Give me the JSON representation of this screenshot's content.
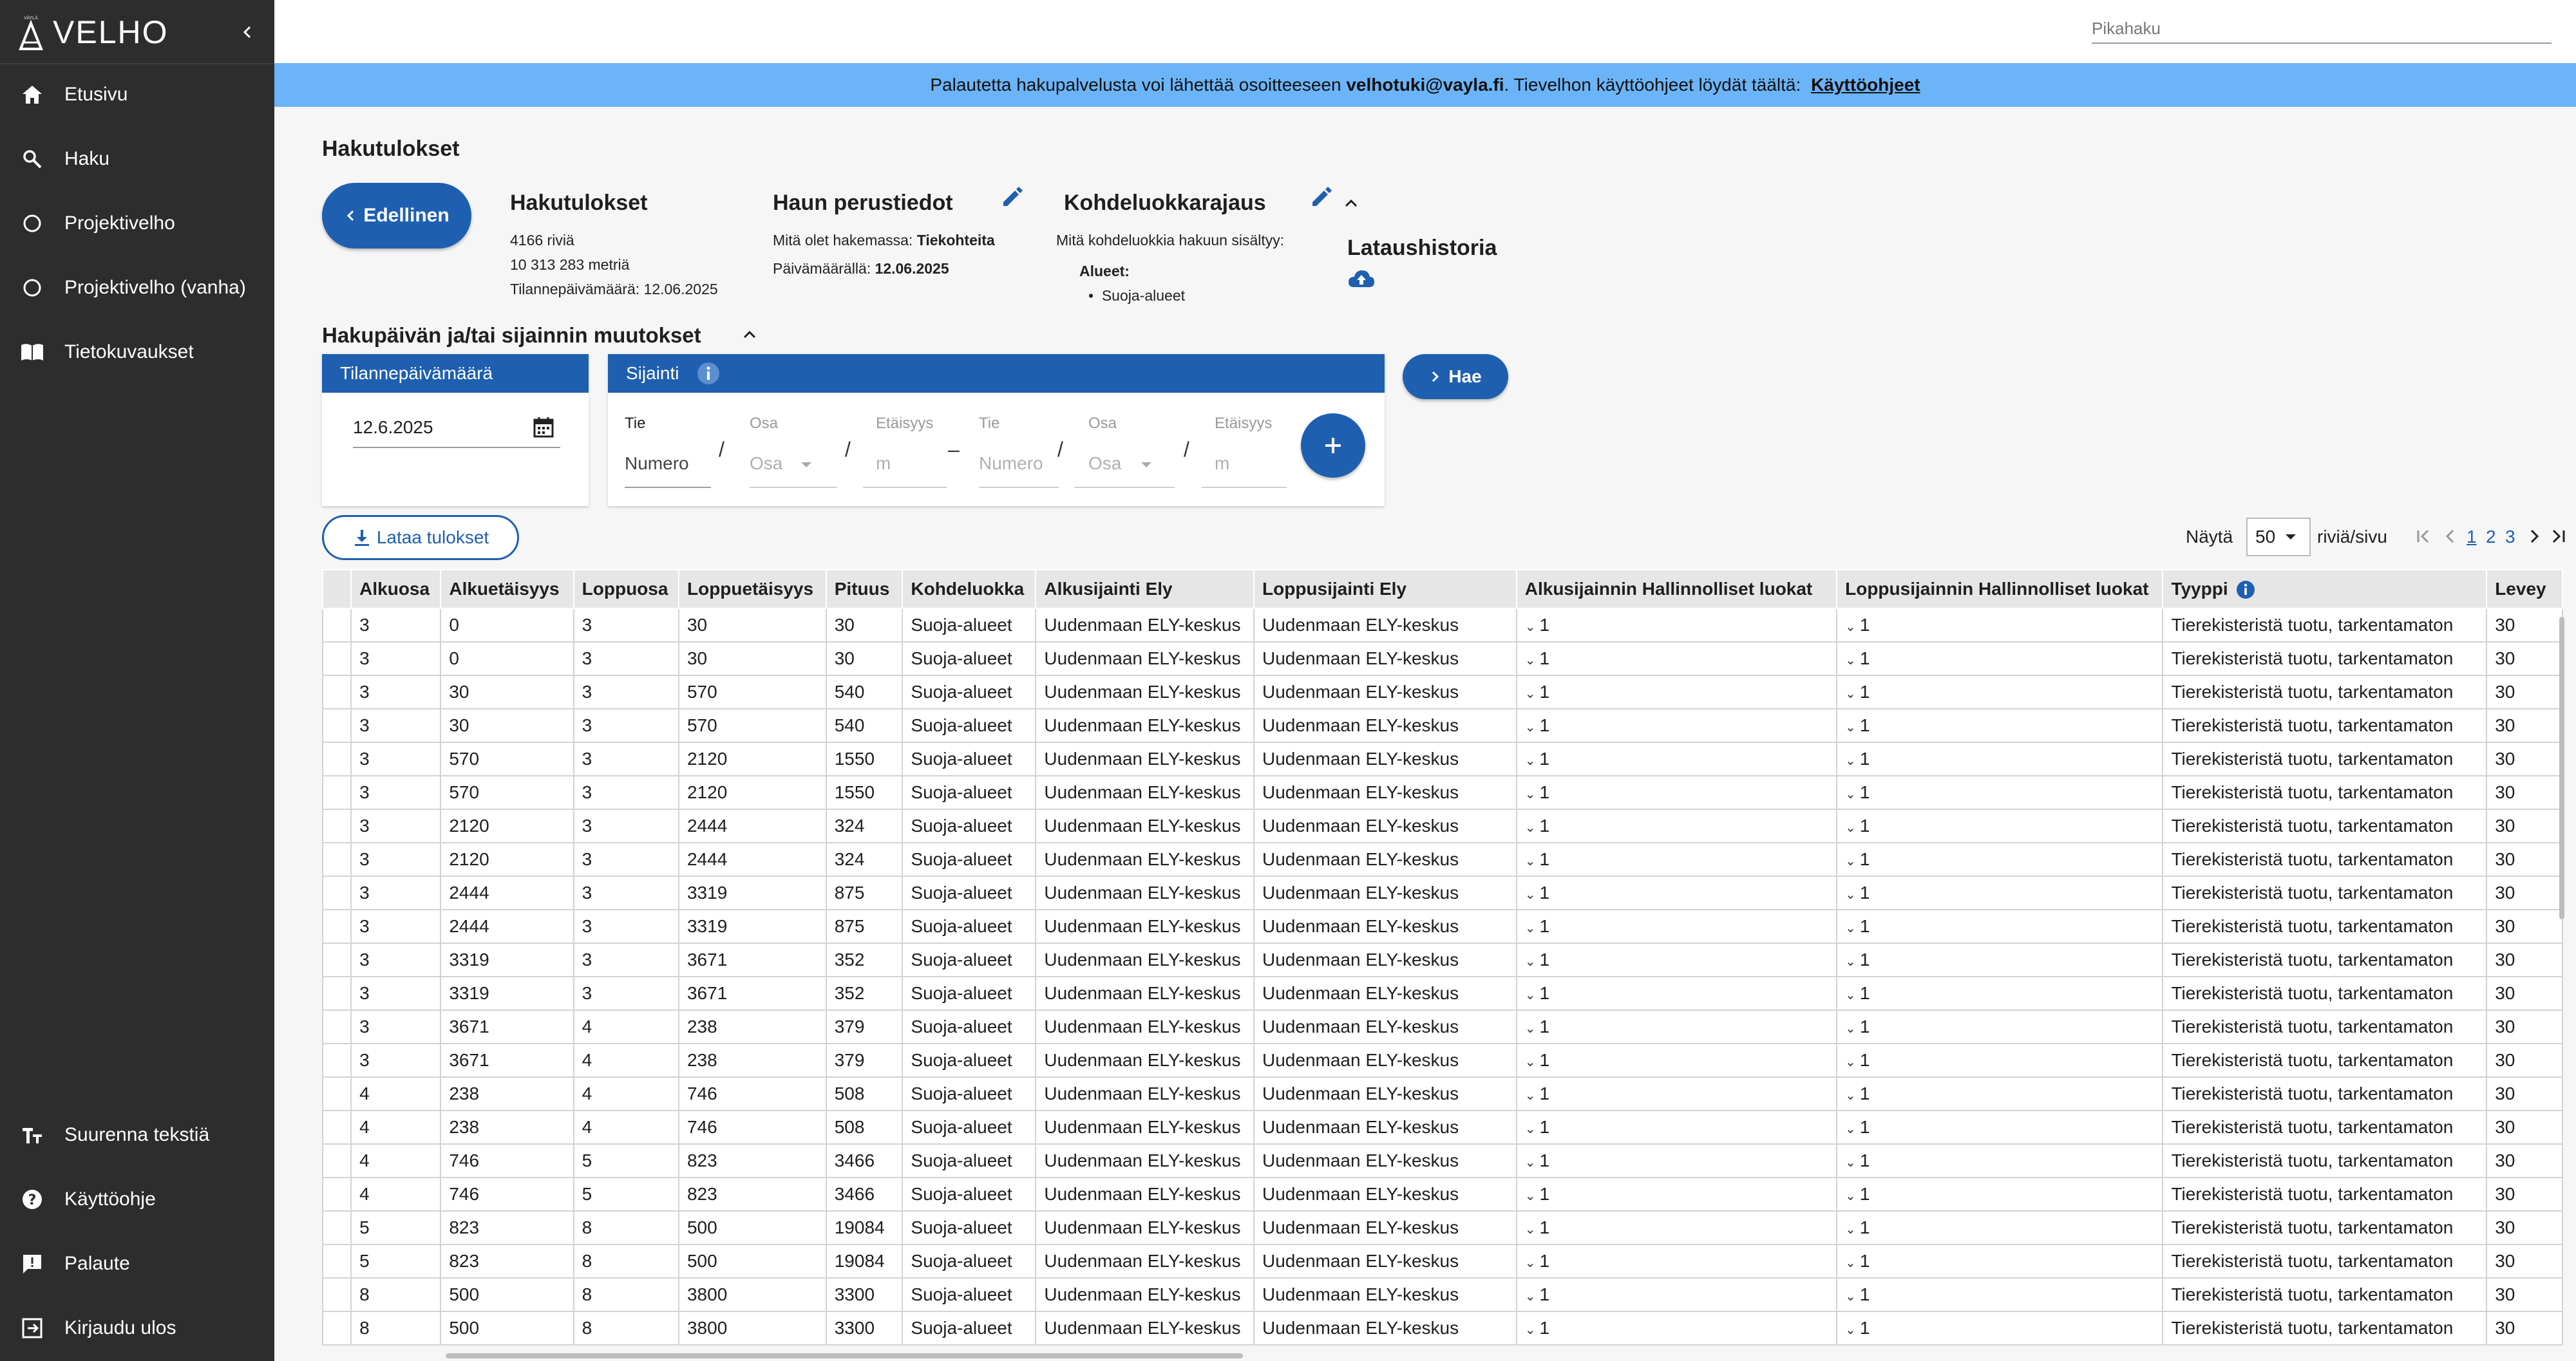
{
  "app": {
    "logo_text": "VELHO",
    "logo_small_text": "VÄYLÄ"
  },
  "sidebar": {
    "items": [
      {
        "label": "Etusivu",
        "icon": "home-icon"
      },
      {
        "label": "Haku",
        "icon": "search-icon"
      },
      {
        "label": "Projektivelho",
        "icon": "circle-icon"
      },
      {
        "label": "Projektivelho (vanha)",
        "icon": "circle-icon"
      },
      {
        "label": "Tietokuvaukset",
        "icon": "book-icon"
      }
    ],
    "bottom_items": [
      {
        "label": "Suurenna tekstiä",
        "icon": "text-size-icon"
      },
      {
        "label": "Käyttöohje",
        "icon": "help-icon"
      },
      {
        "label": "Palaute",
        "icon": "feedback-icon"
      },
      {
        "label": "Kirjaudu ulos",
        "icon": "logout-icon"
      }
    ]
  },
  "topbar": {
    "search_placeholder": "Pikahaku"
  },
  "banner": {
    "text_before": "Palautetta hakupalvelusta voi lähettää osoitteeseen ",
    "email": "velhotuki@vayla.fi",
    "text_middle": ". Tievelhon käyttöohjeet löydät täältä: ",
    "link": "Käyttöohjeet"
  },
  "page": {
    "title": "Hakutulokset",
    "back_label": "Edellinen",
    "results": {
      "title": "Hakutulokset",
      "rows": "4166 riviä",
      "length": "10 313 283 metriä",
      "date": "Tilannepäivämäärä: 12.06.2025"
    },
    "basics": {
      "title": "Haun perustiedot",
      "searching_label": "Mitä olet hakemassa:",
      "searching_value": "Tiekohteita",
      "date_label": "Päivämäärällä:",
      "date_value": "12.06.2025"
    },
    "classes": {
      "title": "Kohdeluokkarajaus",
      "question": "Mitä kohdeluokkia hakuun sisältyy:",
      "areas_label": "Alueet:",
      "areas_item": "Suoja-alueet"
    },
    "history": {
      "title": "Lataushistoria"
    },
    "changes_title": "Hakupäivän ja/tai sijainnin muutokset",
    "date_card": {
      "title": "Tilannepäivämäärä",
      "value": "12.6.2025"
    },
    "location_card": {
      "title": "Sijainti",
      "tie_label": "Tie",
      "tie_placeholder": "Numero",
      "osa_label": "Osa",
      "osa_placeholder": "Osa",
      "etaisyys_label": "Etäisyys",
      "etaisyys_placeholder": "m",
      "tie2_label": "Tie",
      "tie2_placeholder": "Numero",
      "osa2_label": "Osa",
      "osa2_placeholder": "Osa",
      "etaisyys2_label": "Etäisyys",
      "etaisyys2_placeholder": "m"
    },
    "search_button": "Hae",
    "download_button": "Lataa tulokset",
    "pagination": {
      "show_label": "Näytä",
      "per_page": "50",
      "per_page_suffix": "riviä/sivu",
      "pages": [
        "1",
        "2",
        "3"
      ]
    }
  },
  "table": {
    "columns": [
      "",
      "Alkuosa",
      "Alkuetäisyys",
      "Loppuosa",
      "Loppuetäisyys",
      "Pituus",
      "Kohdeluokka",
      "Alkusijainti Ely",
      "Loppusijainti Ely",
      "Alkusijainnin Hallinnolliset luokat",
      "Loppusijainnin Hallinnolliset luokat",
      "Tyyppi",
      "Levey"
    ],
    "rows": [
      [
        "3",
        "0",
        "3",
        "30",
        "30",
        "Suoja-alueet",
        "Uudenmaan ELY-keskus",
        "Uudenmaan ELY-keskus",
        "1",
        "1",
        "Tierekisteristä tuotu, tarkentamaton",
        "30"
      ],
      [
        "3",
        "0",
        "3",
        "30",
        "30",
        "Suoja-alueet",
        "Uudenmaan ELY-keskus",
        "Uudenmaan ELY-keskus",
        "1",
        "1",
        "Tierekisteristä tuotu, tarkentamaton",
        "30"
      ],
      [
        "3",
        "30",
        "3",
        "570",
        "540",
        "Suoja-alueet",
        "Uudenmaan ELY-keskus",
        "Uudenmaan ELY-keskus",
        "1",
        "1",
        "Tierekisteristä tuotu, tarkentamaton",
        "30"
      ],
      [
        "3",
        "30",
        "3",
        "570",
        "540",
        "Suoja-alueet",
        "Uudenmaan ELY-keskus",
        "Uudenmaan ELY-keskus",
        "1",
        "1",
        "Tierekisteristä tuotu, tarkentamaton",
        "30"
      ],
      [
        "3",
        "570",
        "3",
        "2120",
        "1550",
        "Suoja-alueet",
        "Uudenmaan ELY-keskus",
        "Uudenmaan ELY-keskus",
        "1",
        "1",
        "Tierekisteristä tuotu, tarkentamaton",
        "30"
      ],
      [
        "3",
        "570",
        "3",
        "2120",
        "1550",
        "Suoja-alueet",
        "Uudenmaan ELY-keskus",
        "Uudenmaan ELY-keskus",
        "1",
        "1",
        "Tierekisteristä tuotu, tarkentamaton",
        "30"
      ],
      [
        "3",
        "2120",
        "3",
        "2444",
        "324",
        "Suoja-alueet",
        "Uudenmaan ELY-keskus",
        "Uudenmaan ELY-keskus",
        "1",
        "1",
        "Tierekisteristä tuotu, tarkentamaton",
        "30"
      ],
      [
        "3",
        "2120",
        "3",
        "2444",
        "324",
        "Suoja-alueet",
        "Uudenmaan ELY-keskus",
        "Uudenmaan ELY-keskus",
        "1",
        "1",
        "Tierekisteristä tuotu, tarkentamaton",
        "30"
      ],
      [
        "3",
        "2444",
        "3",
        "3319",
        "875",
        "Suoja-alueet",
        "Uudenmaan ELY-keskus",
        "Uudenmaan ELY-keskus",
        "1",
        "1",
        "Tierekisteristä tuotu, tarkentamaton",
        "30"
      ],
      [
        "3",
        "2444",
        "3",
        "3319",
        "875",
        "Suoja-alueet",
        "Uudenmaan ELY-keskus",
        "Uudenmaan ELY-keskus",
        "1",
        "1",
        "Tierekisteristä tuotu, tarkentamaton",
        "30"
      ],
      [
        "3",
        "3319",
        "3",
        "3671",
        "352",
        "Suoja-alueet",
        "Uudenmaan ELY-keskus",
        "Uudenmaan ELY-keskus",
        "1",
        "1",
        "Tierekisteristä tuotu, tarkentamaton",
        "30"
      ],
      [
        "3",
        "3319",
        "3",
        "3671",
        "352",
        "Suoja-alueet",
        "Uudenmaan ELY-keskus",
        "Uudenmaan ELY-keskus",
        "1",
        "1",
        "Tierekisteristä tuotu, tarkentamaton",
        "30"
      ],
      [
        "3",
        "3671",
        "4",
        "238",
        "379",
        "Suoja-alueet",
        "Uudenmaan ELY-keskus",
        "Uudenmaan ELY-keskus",
        "1",
        "1",
        "Tierekisteristä tuotu, tarkentamaton",
        "30"
      ],
      [
        "3",
        "3671",
        "4",
        "238",
        "379",
        "Suoja-alueet",
        "Uudenmaan ELY-keskus",
        "Uudenmaan ELY-keskus",
        "1",
        "1",
        "Tierekisteristä tuotu, tarkentamaton",
        "30"
      ],
      [
        "4",
        "238",
        "4",
        "746",
        "508",
        "Suoja-alueet",
        "Uudenmaan ELY-keskus",
        "Uudenmaan ELY-keskus",
        "1",
        "1",
        "Tierekisteristä tuotu, tarkentamaton",
        "30"
      ],
      [
        "4",
        "238",
        "4",
        "746",
        "508",
        "Suoja-alueet",
        "Uudenmaan ELY-keskus",
        "Uudenmaan ELY-keskus",
        "1",
        "1",
        "Tierekisteristä tuotu, tarkentamaton",
        "30"
      ],
      [
        "4",
        "746",
        "5",
        "823",
        "3466",
        "Suoja-alueet",
        "Uudenmaan ELY-keskus",
        "Uudenmaan ELY-keskus",
        "1",
        "1",
        "Tierekisteristä tuotu, tarkentamaton",
        "30"
      ],
      [
        "4",
        "746",
        "5",
        "823",
        "3466",
        "Suoja-alueet",
        "Uudenmaan ELY-keskus",
        "Uudenmaan ELY-keskus",
        "1",
        "1",
        "Tierekisteristä tuotu, tarkentamaton",
        "30"
      ],
      [
        "5",
        "823",
        "8",
        "500",
        "19084",
        "Suoja-alueet",
        "Uudenmaan ELY-keskus",
        "Uudenmaan ELY-keskus",
        "1",
        "1",
        "Tierekisteristä tuotu, tarkentamaton",
        "30"
      ],
      [
        "5",
        "823",
        "8",
        "500",
        "19084",
        "Suoja-alueet",
        "Uudenmaan ELY-keskus",
        "Uudenmaan ELY-keskus",
        "1",
        "1",
        "Tierekisteristä tuotu, tarkentamaton",
        "30"
      ],
      [
        "8",
        "500",
        "8",
        "3800",
        "3300",
        "Suoja-alueet",
        "Uudenmaan ELY-keskus",
        "Uudenmaan ELY-keskus",
        "1",
        "1",
        "Tierekisteristä tuotu, tarkentamaton",
        "30"
      ],
      [
        "8",
        "500",
        "8",
        "3800",
        "3300",
        "Suoja-alueet",
        "Uudenmaan ELY-keskus",
        "Uudenmaan ELY-keskus",
        "1",
        "1",
        "Tierekisteristä tuotu, tarkentamaton",
        "30"
      ]
    ]
  }
}
